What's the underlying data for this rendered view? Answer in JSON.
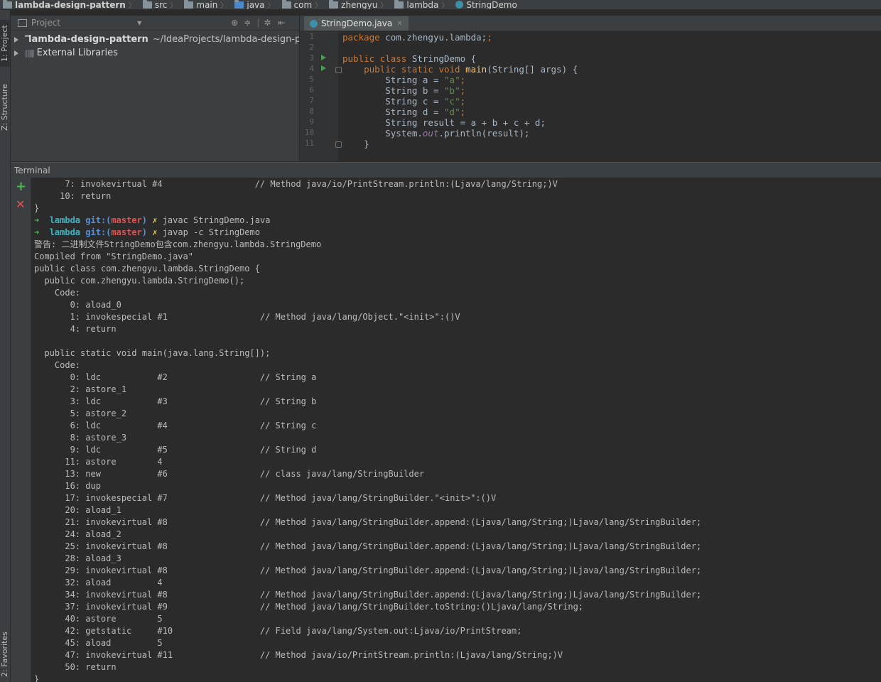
{
  "breadcrumb": [
    "lambda-design-pattern",
    "src",
    "main",
    "java",
    "com",
    "zhengyu",
    "lambda",
    "StringDemo"
  ],
  "sidebar_tabs": {
    "project": "1: Project",
    "structure": "Z: Structure",
    "favorites": "2: Favorites"
  },
  "project_panel": {
    "header": "Project",
    "root_name": "lambda-design-pattern",
    "root_path": "~/IdeaProjects/lambda-design-patt",
    "external": "External Libraries"
  },
  "editor": {
    "tab_label": "StringDemo.java",
    "line_numbers": [
      "1",
      "2",
      "3",
      "4",
      "5",
      "6",
      "7",
      "8",
      "9",
      "10",
      "11"
    ],
    "code": {
      "l1_kw": "package",
      "l1_rest": " com.zhengyu.lambda;",
      "l3_kw": "public class",
      "l3_rest": " StringDemo {",
      "l4_kw": "public static void",
      "l4_fn": "main",
      "l4_rest": "(String[] args) {",
      "l5_a": "String a = ",
      "l5_s": "\"a\"",
      "l6_a": "String b = ",
      "l6_s": "\"b\"",
      "l7_a": "String c = ",
      "l7_s": "\"c\"",
      "l8_a": "String d = ",
      "l8_s": "\"d\"",
      "l9": "String result = a + b + c + d;",
      "l10_a": "System.",
      "l10_f": "out",
      "l10_b": ".println(result);",
      "l11": "}"
    }
  },
  "terminal": {
    "title": "Terminal",
    "prompt": {
      "arrow": "➜",
      "dir": "lambda",
      "git": "git:(",
      "branch": "master",
      "git_close": ")",
      "dirty": "✗"
    },
    "cmd1": "javac StringDemo.java",
    "cmd2": "javap -c StringDemo",
    "lines": [
      "      7: invokevirtual #4                  // Method java/io/PrintStream.println:(Ljava/lang/String;)V",
      "     10: return",
      "}",
      "",
      "",
      "警告: 二进制文件StringDemo包含com.zhengyu.lambda.StringDemo",
      "Compiled from \"StringDemo.java\"",
      "public class com.zhengyu.lambda.StringDemo {",
      "  public com.zhengyu.lambda.StringDemo();",
      "    Code:",
      "       0: aload_0",
      "       1: invokespecial #1                  // Method java/lang/Object.\"<init>\":()V",
      "       4: return",
      "",
      "  public static void main(java.lang.String[]);",
      "    Code:",
      "       0: ldc           #2                  // String a",
      "       2: astore_1",
      "       3: ldc           #3                  // String b",
      "       5: astore_2",
      "       6: ldc           #4                  // String c",
      "       8: astore_3",
      "       9: ldc           #5                  // String d",
      "      11: astore        4",
      "      13: new           #6                  // class java/lang/StringBuilder",
      "      16: dup",
      "      17: invokespecial #7                  // Method java/lang/StringBuilder.\"<init>\":()V",
      "      20: aload_1",
      "      21: invokevirtual #8                  // Method java/lang/StringBuilder.append:(Ljava/lang/String;)Ljava/lang/StringBuilder;",
      "      24: aload_2",
      "      25: invokevirtual #8                  // Method java/lang/StringBuilder.append:(Ljava/lang/String;)Ljava/lang/StringBuilder;",
      "      28: aload_3",
      "      29: invokevirtual #8                  // Method java/lang/StringBuilder.append:(Ljava/lang/String;)Ljava/lang/StringBuilder;",
      "      32: aload         4",
      "      34: invokevirtual #8                  // Method java/lang/StringBuilder.append:(Ljava/lang/String;)Ljava/lang/StringBuilder;",
      "      37: invokevirtual #9                  // Method java/lang/StringBuilder.toString:()Ljava/lang/String;",
      "      40: astore        5",
      "      42: getstatic     #10                 // Field java/lang/System.out:Ljava/io/PrintStream;",
      "      45: aload         5",
      "      47: invokevirtual #11                 // Method java/io/PrintStream.println:(Ljava/lang/String;)V",
      "      50: return",
      "}"
    ]
  },
  "icons": {
    "add": "plus-icon",
    "close": "close-icon",
    "settings": "gear-icon"
  },
  "colors": {
    "accent_green": "#4eb84e",
    "close_red": "#e05252",
    "background": "#2b2b2b"
  }
}
